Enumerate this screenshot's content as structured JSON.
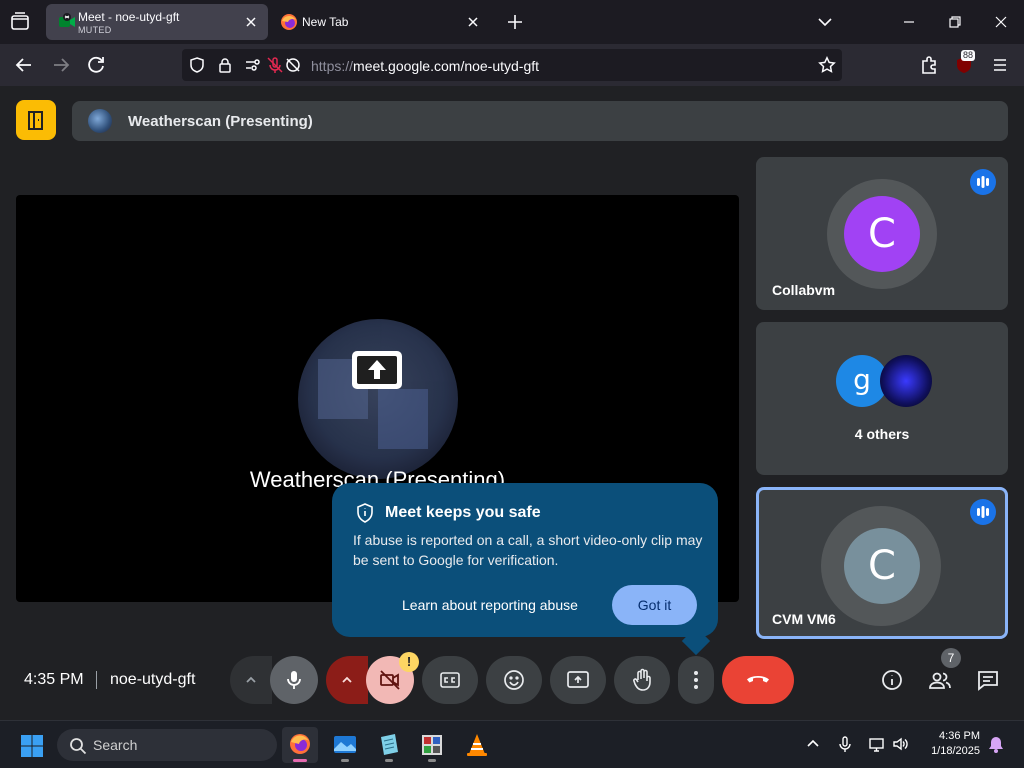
{
  "browser": {
    "tabs": [
      {
        "title": "Meet - noe-utyd-gft",
        "subtitle": "MUTED",
        "active": true
      },
      {
        "title": "New Tab",
        "subtitle": "",
        "active": false
      }
    ],
    "url_prefix": "https://",
    "url_host": "meet.google.com",
    "url_path": "/noe-utyd-gft",
    "extensions_badge": "88"
  },
  "meet": {
    "banner_text": "Weatherscan (Presenting)",
    "stage_label": "Weatherscan (Presenting)",
    "participants": [
      {
        "name": "Collabvm",
        "initial": "C",
        "color": "#a142f4",
        "speaking": true
      },
      {
        "name": "4 others",
        "initials": [
          "g",
          ""
        ],
        "color": "#1e88e5"
      },
      {
        "name": "CVM VM6",
        "initial": "C",
        "color": "#78909c",
        "speaking": true,
        "highlighted": true
      }
    ],
    "popup": {
      "title": "Meet keeps you safe",
      "body": "If abuse is reported on a call, a short video-only clip may be sent to Google for verification.",
      "link": "Learn about reporting abuse",
      "button": "Got it"
    },
    "controls": {
      "time": "4:35 PM",
      "meeting_code": "noe-utyd-gft",
      "camera_warning": "!",
      "people_count": "7"
    }
  },
  "taskbar": {
    "search_label": "Search",
    "time": "4:36 PM",
    "date": "1/18/2025"
  },
  "colors": {
    "accent_blue": "#8ab4f8",
    "hangup_red": "#ea4335",
    "door_yellow": "#fbbc04",
    "popup_bg": "#0b4f7a"
  }
}
